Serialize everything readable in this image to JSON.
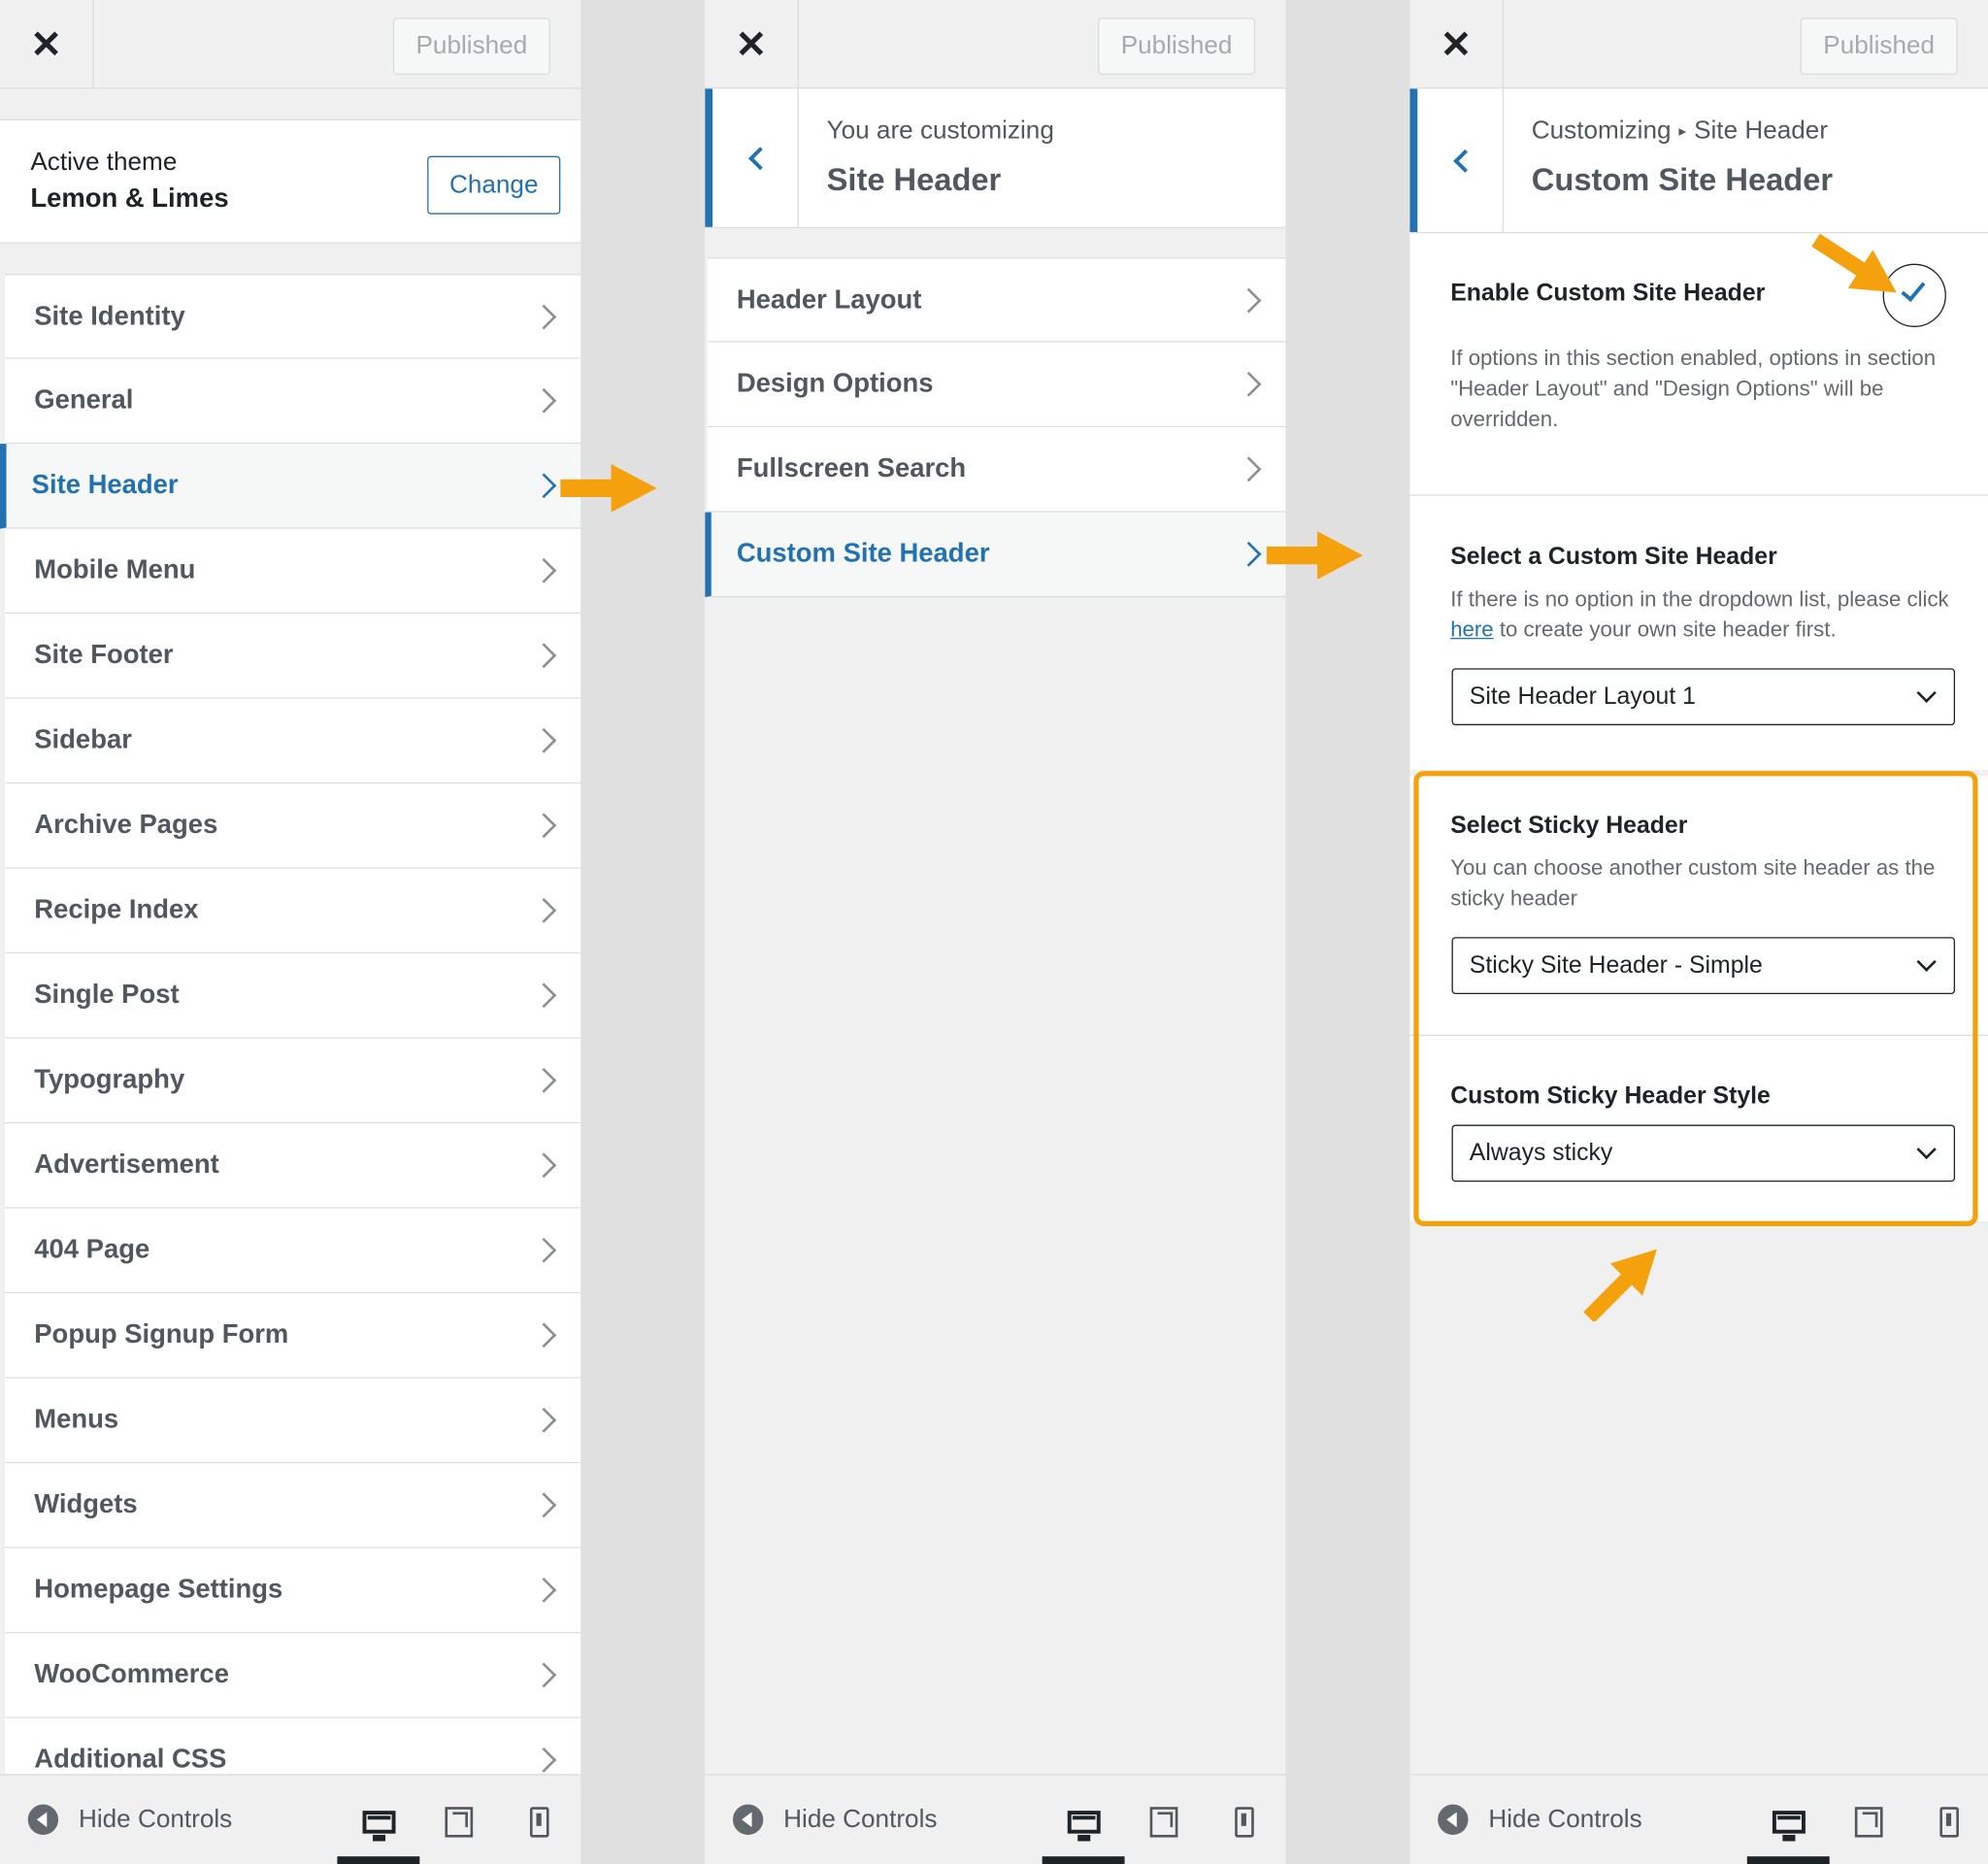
{
  "colors": {
    "accent": "#2271b1",
    "annotation": "#f5a10e"
  },
  "topbar": {
    "close_icon": "✕",
    "publish_label": "Published"
  },
  "panel1": {
    "theme_label": "Active theme",
    "theme_name": "Lemon & Limes",
    "change_label": "Change",
    "items": [
      "Site Identity",
      "General",
      "Site Header",
      "Mobile Menu",
      "Site Footer",
      "Sidebar",
      "Archive Pages",
      "Recipe Index",
      "Single Post",
      "Typography",
      "Advertisement",
      "404 Page",
      "Popup Signup Form",
      "Menus",
      "Widgets",
      "Homepage Settings",
      "WooCommerce",
      "Additional CSS"
    ],
    "active_item": "Site Header"
  },
  "panel2": {
    "subtitle": "You are customizing",
    "title": "Site Header",
    "items": [
      "Header Layout",
      "Design Options",
      "Fullscreen Search",
      "Custom Site Header"
    ],
    "active_item": "Custom Site Header"
  },
  "panel3": {
    "crumb_root": "Customizing",
    "crumb_sep": "▸",
    "crumb_parent": "Site Header",
    "title": "Custom Site Header",
    "enable": {
      "title": "Enable Custom Site Header",
      "checked": true,
      "description": "If options in this section enabled, options in section \"Header Layout\" and \"Design Options\" will be overridden."
    },
    "select_custom": {
      "title": "Select a Custom Site Header",
      "desc_before": "If there is no option in the dropdown list, please click ",
      "desc_link": "here",
      "desc_after": " to create your own site header first.",
      "value": "Site Header Layout 1"
    },
    "select_sticky": {
      "title": "Select Sticky Header",
      "description": "You can choose another custom site header as the sticky header",
      "value": "Sticky Site Header - Simple"
    },
    "sticky_style": {
      "title": "Custom Sticky Header Style",
      "value": "Always sticky"
    }
  },
  "footer": {
    "hide_label": "Hide Controls",
    "devices": [
      "desktop",
      "tablet",
      "mobile"
    ],
    "active_device": "desktop"
  }
}
